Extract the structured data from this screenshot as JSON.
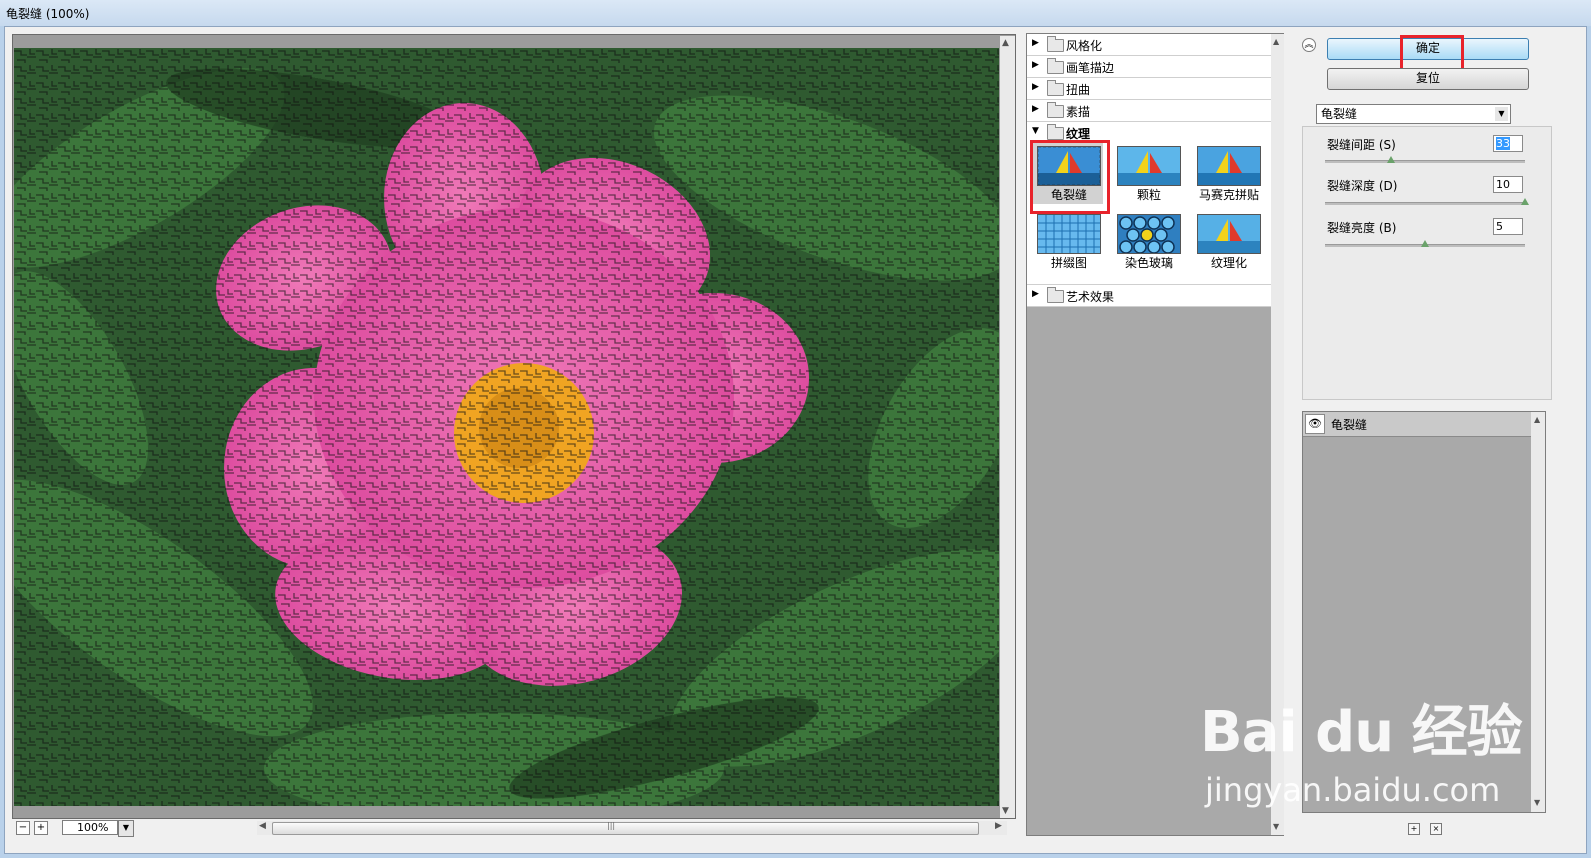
{
  "window": {
    "title": "龟裂缝 (100%)"
  },
  "preview": {
    "zoom_value": "100%",
    "zoom_out": "−",
    "zoom_in": "+"
  },
  "gallery": {
    "categories": [
      {
        "label": "风格化",
        "expanded": false
      },
      {
        "label": "画笔描边",
        "expanded": false
      },
      {
        "label": "扭曲",
        "expanded": false
      },
      {
        "label": "素描",
        "expanded": false
      },
      {
        "label": "纹理",
        "expanded": true
      },
      {
        "label": "艺术效果",
        "expanded": false
      }
    ],
    "texture_filters": [
      {
        "label": "龟裂缝",
        "selected": true
      },
      {
        "label": "颗粒",
        "selected": false
      },
      {
        "label": "马赛克拼贴",
        "selected": false
      },
      {
        "label": "拼缀图",
        "selected": false
      },
      {
        "label": "染色玻璃",
        "selected": false
      },
      {
        "label": "纹理化",
        "selected": false
      }
    ]
  },
  "controls": {
    "ok_label": "确定",
    "reset_label": "复位",
    "filter_select_value": "龟裂缝",
    "params": [
      {
        "label": "裂缝间距 (S)",
        "value": "33",
        "slider_fraction": 0.33
      },
      {
        "label": "裂缝深度 (D)",
        "value": "10",
        "slider_fraction": 1.0
      },
      {
        "label": "裂缝亮度 (B)",
        "value": "5",
        "slider_fraction": 0.5
      }
    ]
  },
  "layers": {
    "items": [
      {
        "name": "龟裂缝",
        "visible": true
      }
    ]
  },
  "watermark": {
    "brand": "Bai du 经验",
    "site": "jingyan.baidu.com"
  },
  "colors": {
    "highlight_box": "#e8232b",
    "ok_button": "#a9dbf6",
    "panel_gray": "#a9a9a9"
  }
}
